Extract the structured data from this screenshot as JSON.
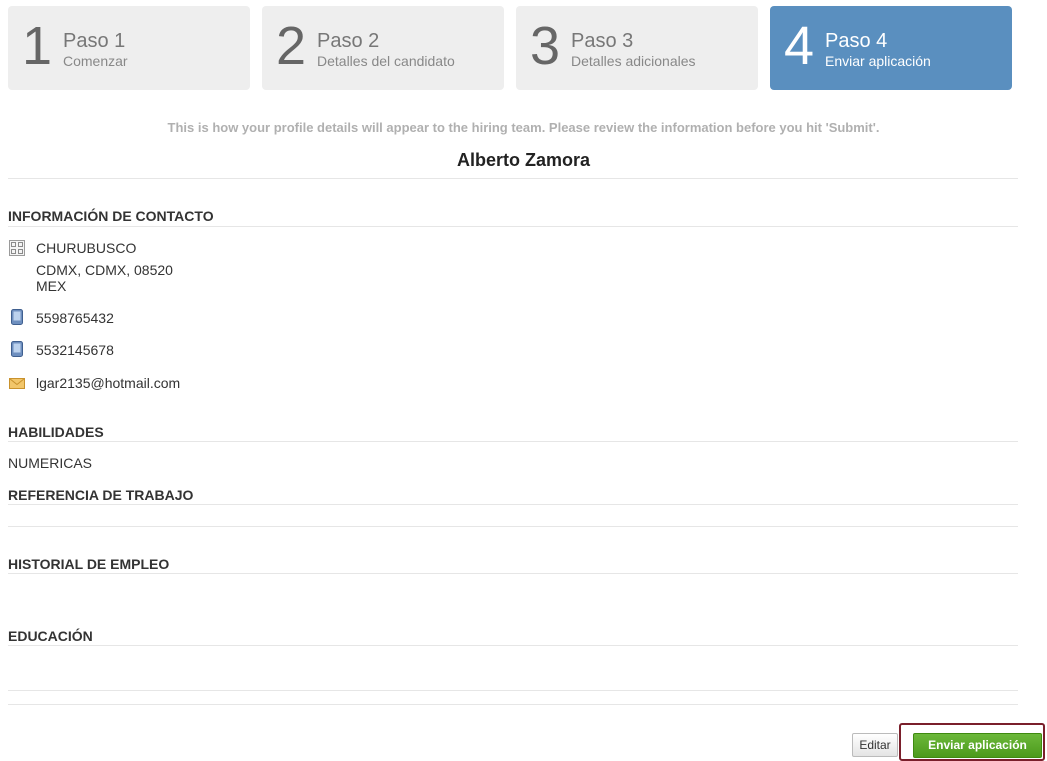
{
  "steps": [
    {
      "number": "1",
      "title": "Paso 1",
      "subtitle": "Comenzar"
    },
    {
      "number": "2",
      "title": "Paso 2",
      "subtitle": "Detalles del candidato"
    },
    {
      "number": "3",
      "title": "Paso 3",
      "subtitle": "Detalles adicionales"
    },
    {
      "number": "4",
      "title": "Paso 4",
      "subtitle": "Enviar aplicación"
    }
  ],
  "active_step": 4,
  "intro_text": "This is how your profile details will appear to the hiring team. Please review the information before you hit 'Submit'.",
  "candidate_name": "Alberto Zamora",
  "contact": {
    "section_title": "INFORMACIÓN DE CONTACTO",
    "address": {
      "line1": "CHURUBUSCO",
      "line2": "CDMX, CDMX, 08520",
      "line3": "MEX",
      "icon": "address-icon"
    },
    "phones": [
      {
        "number": "5598765432",
        "icon": "phone-icon"
      },
      {
        "number": "5532145678",
        "icon": "phone-icon"
      }
    ],
    "email": {
      "value": "lgar2135@hotmail.com",
      "icon": "envelope-icon"
    }
  },
  "skills": {
    "section_title": "HABILIDADES",
    "value": "NUMERICAS"
  },
  "work_reference": {
    "section_title": "REFERENCIA DE TRABAJO"
  },
  "employment_history": {
    "section_title": "HISTORIAL DE EMPLEO"
  },
  "education": {
    "section_title": "EDUCACIÓN"
  },
  "actions": {
    "edit_label": "Editar",
    "submit_label": "Enviar aplicación"
  },
  "colors": {
    "active_step": "#5a8fbf",
    "inactive_step": "#eeeeee",
    "submit_button": "#5aa828",
    "highlight_border": "#7a1f2b"
  }
}
